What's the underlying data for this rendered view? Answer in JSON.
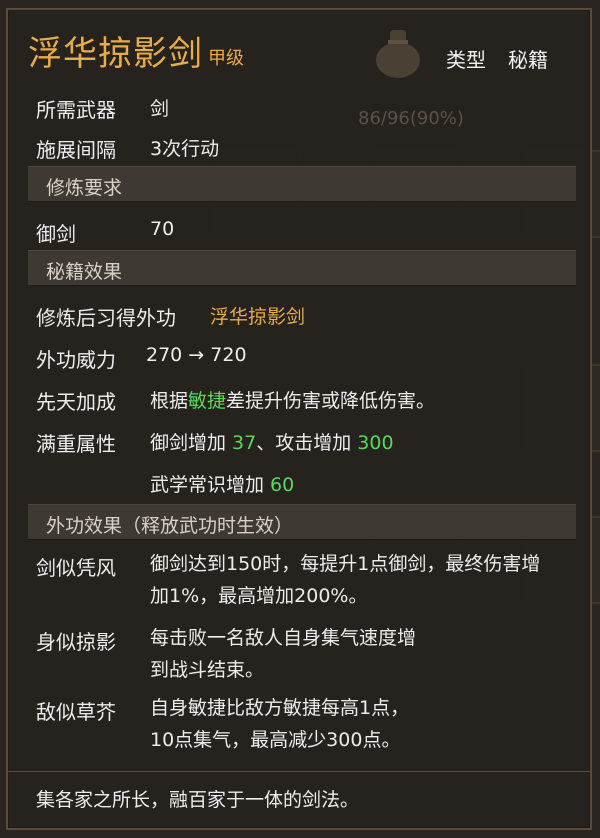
{
  "skill": {
    "name": "浮华掠影剑",
    "grade": "甲级",
    "type_label": "类型",
    "type_value": "秘籍"
  },
  "background": {
    "durability": "86/96(90%)"
  },
  "basic": {
    "weapon_label": "所需武器",
    "weapon_value": "剑",
    "interval_label": "施展间隔",
    "interval_value": "3次行动"
  },
  "requirements": {
    "header": "修炼要求",
    "stat_label": "御剑",
    "stat_value": "70"
  },
  "effects": {
    "header": "秘籍效果",
    "learn_label": "修炼后习得外功",
    "learn_value": "浮华掠影剑",
    "power_label": "外功威力",
    "power_value": "270 → 720",
    "innate_label": "先天加成",
    "innate_pre": "根据",
    "innate_attr": "敏捷",
    "innate_post": "差提升伤害或降低伤害。",
    "full_label": "满重属性",
    "full_line1_a": "御剑增加 ",
    "full_line1_b": "37",
    "full_line1_c": "、攻击增加 ",
    "full_line1_d": "300",
    "full_line2_a": "武学常识增加 ",
    "full_line2_b": "60"
  },
  "passives": {
    "header": "外功效果（释放武功时生效）",
    "items": [
      {
        "name": "剑似凭风",
        "line1": "御剑达到150时，每提升1点御剑，最终伤害增",
        "line2": "加1%，最高增加200%。"
      },
      {
        "name": "身似掠影",
        "line1": "每击败一名敌人自身集气速度增",
        "line2": "到战斗结束。"
      },
      {
        "name": "敌似草芥",
        "line1": "自身敏捷比敌方敏捷每高1点，",
        "line2": "10点集气，最高减少300点。"
      }
    ]
  },
  "flavor": "集各家之所长，融百家于一体的剑法。"
}
